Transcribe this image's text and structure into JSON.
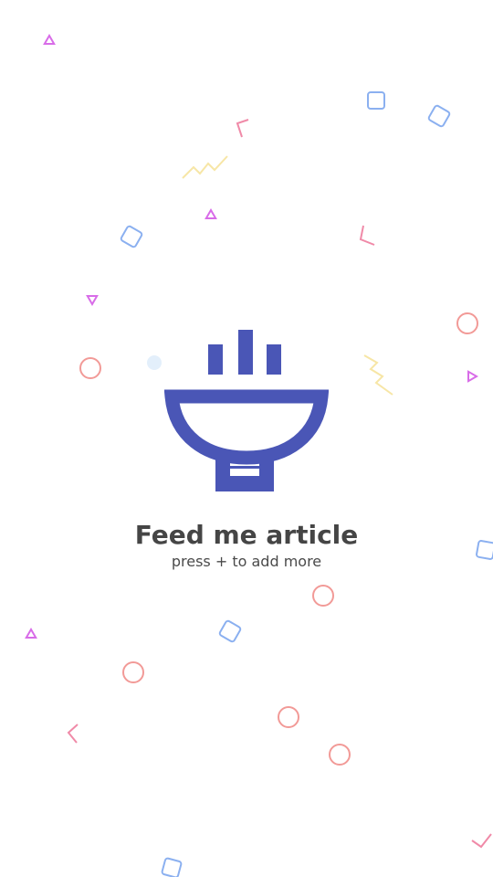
{
  "empty_state": {
    "icon": "noodle-bowl-icon",
    "icon_color": "#4a56b6",
    "title": "Feed me article",
    "subtitle": "press + to add more"
  },
  "theme": {
    "background": "#ffffff",
    "text_color": "#454545",
    "confetti_colors": {
      "triangle": "#d86ce8",
      "square": "#8bb0f0",
      "circle": "#f29a97",
      "chevron": "#f08aa8",
      "zigzag": "#f7e6a6",
      "dot": "#e3effb"
    }
  }
}
